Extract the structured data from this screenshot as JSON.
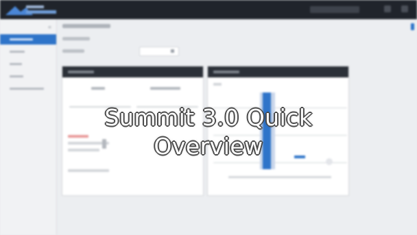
{
  "video": {
    "title_line1": "Summit 3.0 Quick",
    "title_line2": "Overview"
  },
  "colors": {
    "accent": "#2e74c9",
    "topbar": "#20242b",
    "panel_header": "#2b3038"
  },
  "icons": {
    "collapse": "double-chevron-left-icon",
    "logo": "summit-logo"
  }
}
